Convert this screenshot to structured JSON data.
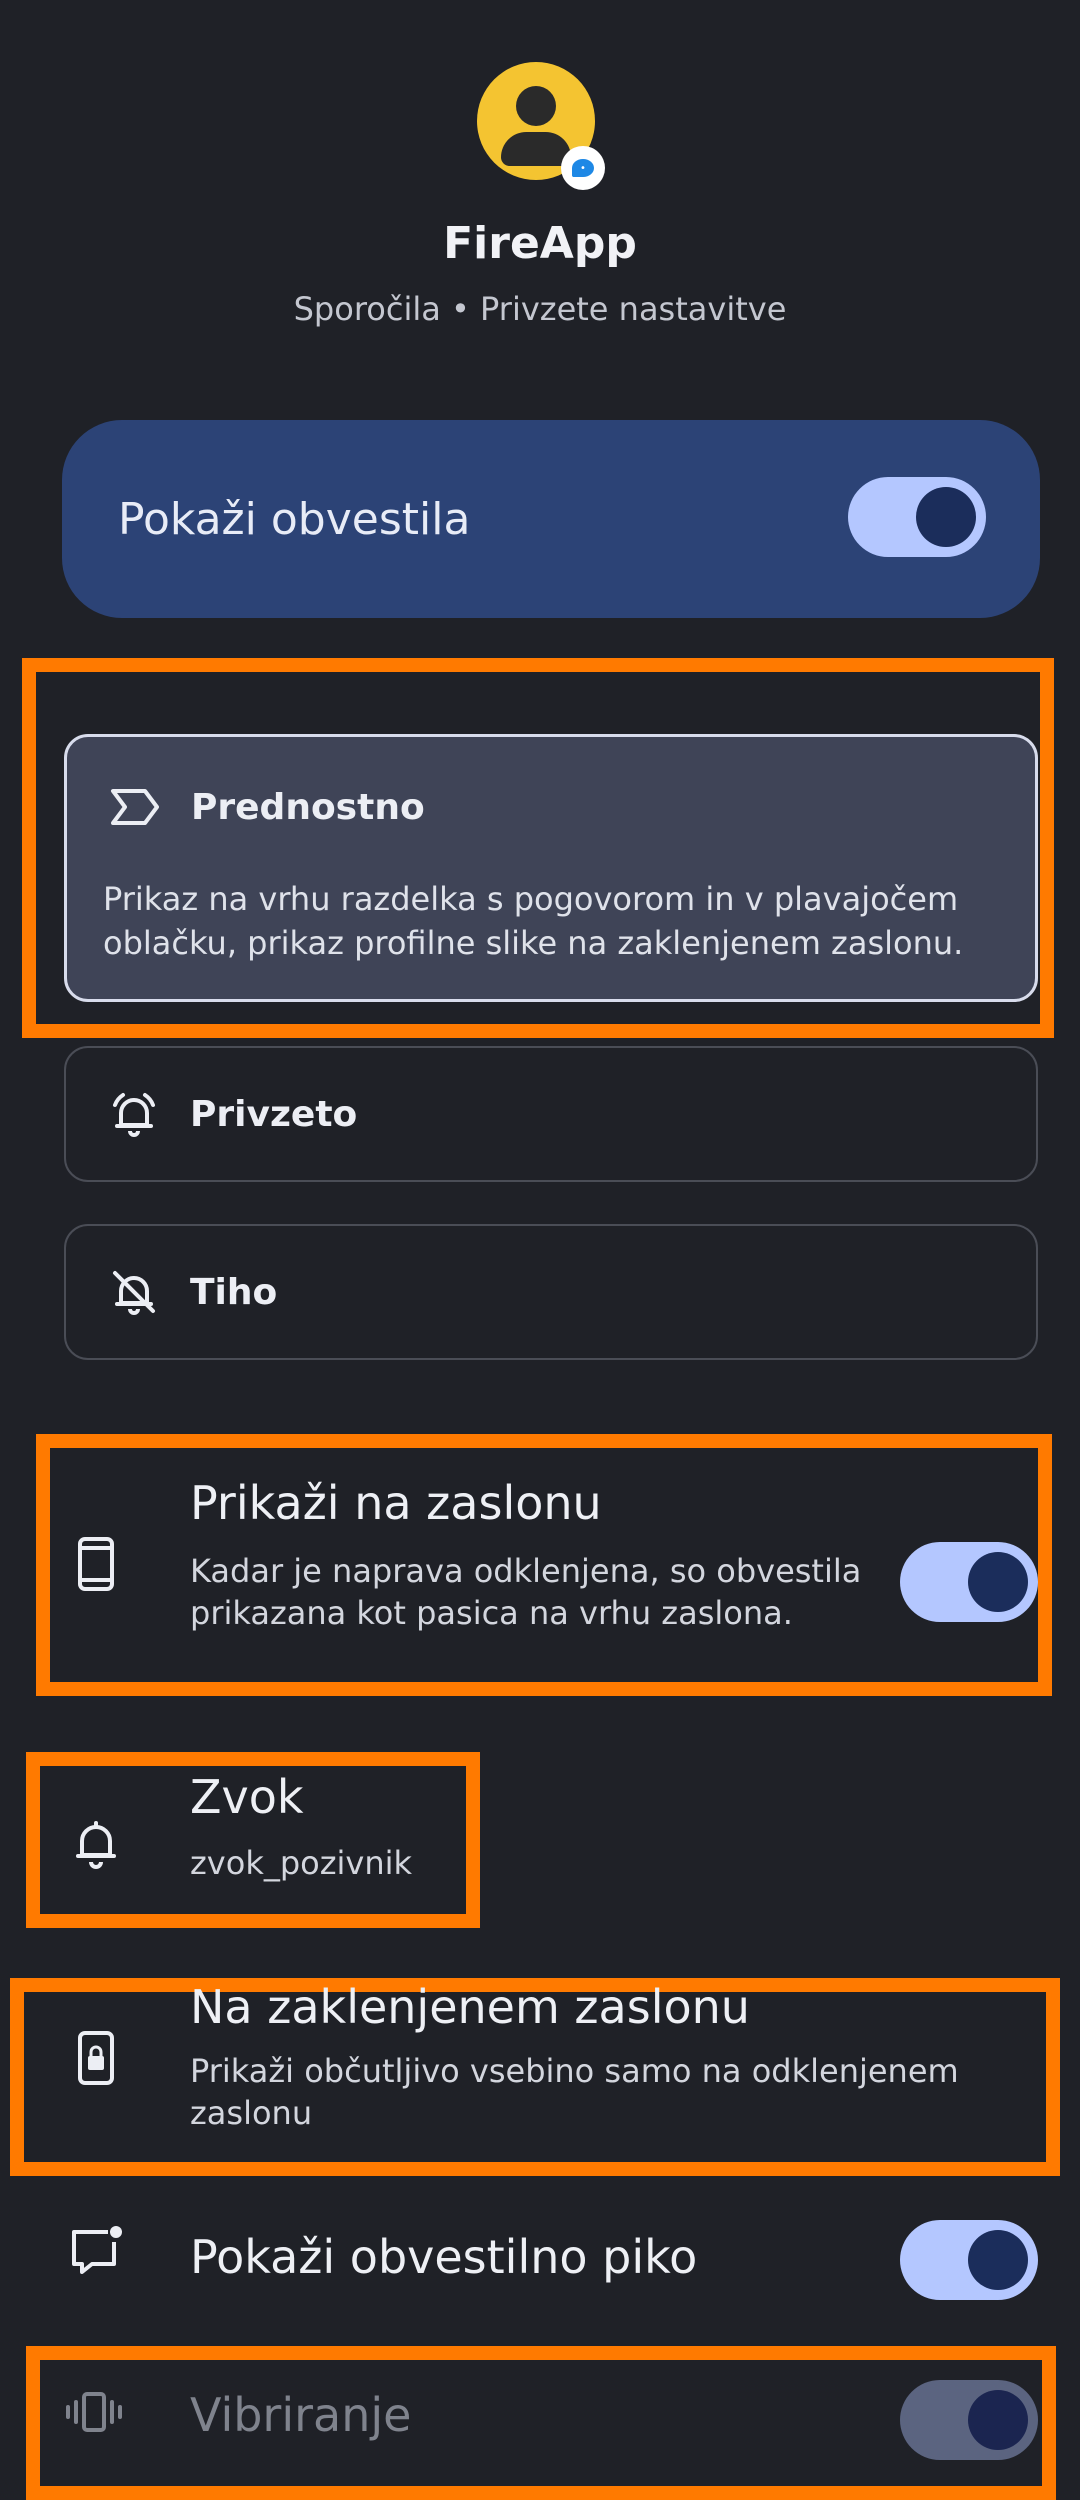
{
  "header": {
    "app_name": "FireApp",
    "subtitle": "Sporočila • Privzete nastavitve",
    "avatar_icon": "person-avatar-icon",
    "badge_icon": "chat-bubble-icon"
  },
  "main_toggle": {
    "label": "Pokaži obvestila",
    "on": true
  },
  "options": [
    {
      "label": "Prednostno",
      "icon": "priority-icon",
      "selected": true,
      "description": "Prikaz na vrhu razdelka s pogovorom in v plavajočem oblačku, prikaz profilne slike na zaklenjenem zaslonu."
    },
    {
      "label": "Privzeto",
      "icon": "bell-ringing-icon",
      "selected": false
    },
    {
      "label": "Tiho",
      "icon": "bell-off-icon",
      "selected": false
    }
  ],
  "settings": {
    "show_on_screen": {
      "title": "Prikaži na zaslonu",
      "subtitle": "Kadar je naprava odklenjena, so obvestila prikazana kot pasica na vrhu zaslona.",
      "icon": "phone-icon",
      "on": true
    },
    "sound": {
      "title": "Zvok",
      "subtitle": "zvok_pozivnik",
      "icon": "bell-icon"
    },
    "lock_screen": {
      "title": "Na zaklenjenem zaslonu",
      "subtitle": "Prikaži občutljivo vsebino samo na odklenjenem zaslonu",
      "icon": "lock-screen-icon"
    },
    "dot": {
      "title": "Pokaži obvestilno piko",
      "icon": "notification-dot-icon",
      "on": true
    },
    "vibration": {
      "title": "Vibriranje",
      "icon": "vibration-icon",
      "on": true,
      "enabled": false
    }
  },
  "colors": {
    "background": "#1f2127",
    "accent": "#b4c7ff",
    "card": "#2c4376",
    "highlight": "#ff7a00"
  }
}
